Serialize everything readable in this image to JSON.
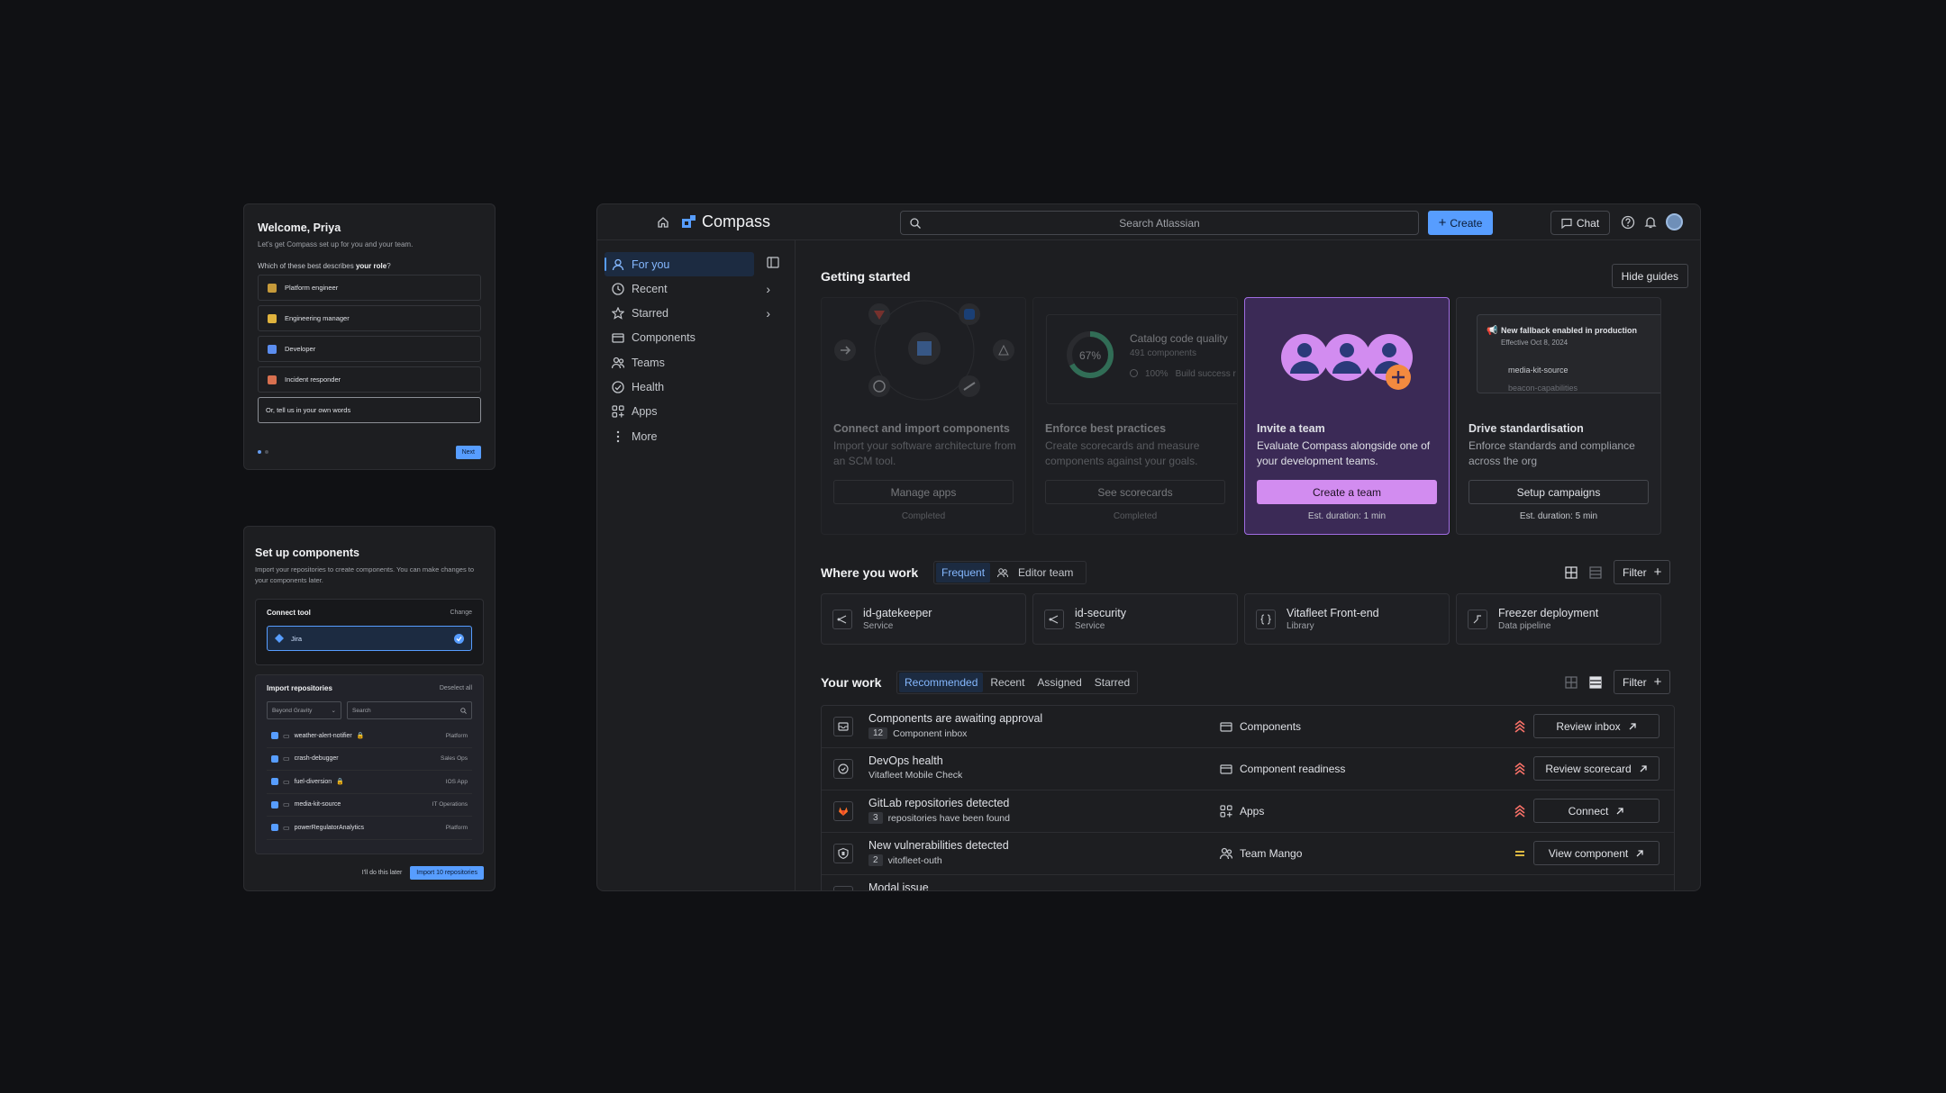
{
  "onboarding": {
    "title": "Welcome, Priya",
    "subtitle": "Let's get Compass set up for you and your team.",
    "question_prefix": "Which of these best describes ",
    "question_bold": "your role",
    "question_suffix": "?",
    "roles": [
      {
        "label": "Platform engineer",
        "color": "#c69a3a"
      },
      {
        "label": "Engineering manager",
        "color": "#e0b33d"
      },
      {
        "label": "Developer",
        "color": "#5b8def"
      },
      {
        "label": "Incident responder",
        "color": "#d8704f"
      }
    ],
    "own_words_placeholder": "Or, tell us in your own words",
    "next_label": "Next"
  },
  "setup": {
    "title": "Set up components",
    "subtitle": "Import your repositories to create components. You can make changes to your components later.",
    "connect_tool_label": "Connect tool",
    "change_label": "Change",
    "tool_name": "Jira",
    "import_label": "Import repositories",
    "deselect_label": "Deselect all",
    "org_select": "Beyond Gravity",
    "search_placeholder": "Search",
    "repos": [
      {
        "name": "weather-alert-notifier",
        "team": "Platform",
        "locked": true
      },
      {
        "name": "crash-debugger",
        "team": "Sales Ops",
        "locked": false
      },
      {
        "name": "fuel-diversion",
        "team": "IOS App",
        "locked": true
      },
      {
        "name": "media-kit-source",
        "team": "IT Operations",
        "locked": false
      },
      {
        "name": "powerRegulatorAnalytics",
        "team": "Platform",
        "locked": false
      }
    ],
    "later_label": "I'll do this later",
    "import_button": "Import 10 repositories"
  },
  "app": {
    "name": "Compass",
    "search_placeholder": "Search Atlassian",
    "create_label": "Create",
    "chat_label": "Chat"
  },
  "sidebar": {
    "items": [
      {
        "label": "For you",
        "icon": "person-icon",
        "active": true
      },
      {
        "label": "Recent",
        "icon": "clock-icon",
        "chevron": true
      },
      {
        "label": "Starred",
        "icon": "star-icon",
        "chevron": true
      },
      {
        "label": "Components",
        "icon": "components-icon"
      },
      {
        "label": "Teams",
        "icon": "people-icon"
      },
      {
        "label": "Health",
        "icon": "health-icon"
      },
      {
        "label": "Apps",
        "icon": "apps-icon"
      },
      {
        "label": "More",
        "icon": "more-icon"
      }
    ]
  },
  "getting_started": {
    "title": "Getting started",
    "hide_label": "Hide guides",
    "cards": [
      {
        "title": "Connect and import components",
        "desc": "Import your software architecture from an SCM tool.",
        "button": "Manage apps",
        "footer": "Completed"
      },
      {
        "title": "Enforce best practices",
        "desc": "Create scorecards and measure components against your goals.",
        "button": "See scorecards",
        "footer": "Completed",
        "preview_title": "Catalog code quality",
        "preview_sub": "491 components",
        "preview_pct": "67%",
        "preview_row1_pct": "100%",
        "preview_row1": "Build success r"
      },
      {
        "title": "Invite a team",
        "desc": "Evaluate Compass alongside one of your development teams.",
        "button": "Create a team",
        "footer": "Est. duration: 1 min"
      },
      {
        "title": "Drive standardisation",
        "desc": "Enforce standards and compliance across the org",
        "button": "Setup campaigns",
        "footer": "Est. duration: 5 min",
        "preview_title": "New fallback enabled in production",
        "preview_sub": "Effective Oct 8, 2024",
        "preview_item1": "media-kit-source",
        "preview_item2": "beacon-capabilities"
      }
    ]
  },
  "where_you_work": {
    "title": "Where you work",
    "tabs": [
      "Frequent",
      "Editor team"
    ],
    "filter_label": "Filter",
    "items": [
      {
        "name": "id-gatekeeper",
        "type": "Service"
      },
      {
        "name": "id-security",
        "type": "Service"
      },
      {
        "name": "Vitafleet Front-end",
        "type": "Library"
      },
      {
        "name": "Freezer deployment",
        "type": "Data pipeline"
      }
    ]
  },
  "your_work": {
    "title": "Your work",
    "tabs": [
      "Recommended",
      "Recent",
      "Assigned",
      "Starred"
    ],
    "filter_label": "Filter",
    "rows": [
      {
        "title": "Components are awaiting approval",
        "count": "12",
        "sub": "Component inbox",
        "category": "Components",
        "priority": "high",
        "action": "Review inbox"
      },
      {
        "title": "DevOps health",
        "count": "",
        "sub": "Vitafleet Mobile Check",
        "category": "Component readiness",
        "priority": "high",
        "action": "Review scorecard"
      },
      {
        "title": "GitLab repositories detected",
        "count": "3",
        "sub": "repositories have been found",
        "category": "Apps",
        "priority": "high",
        "action": "Connect"
      },
      {
        "title": "New vulnerabilities detected",
        "count": "2",
        "sub": "vitofleet-outh",
        "category": "Team Mango",
        "priority": "medium",
        "action": "View component"
      },
      {
        "title": "Modal issue",
        "count": "",
        "sub": "",
        "category": "",
        "priority": "",
        "action": ""
      }
    ]
  },
  "colors": {
    "accent": "#579dff",
    "highlight": "#a06de2",
    "priority_high": "#f87168",
    "priority_medium": "#f5cd47"
  }
}
